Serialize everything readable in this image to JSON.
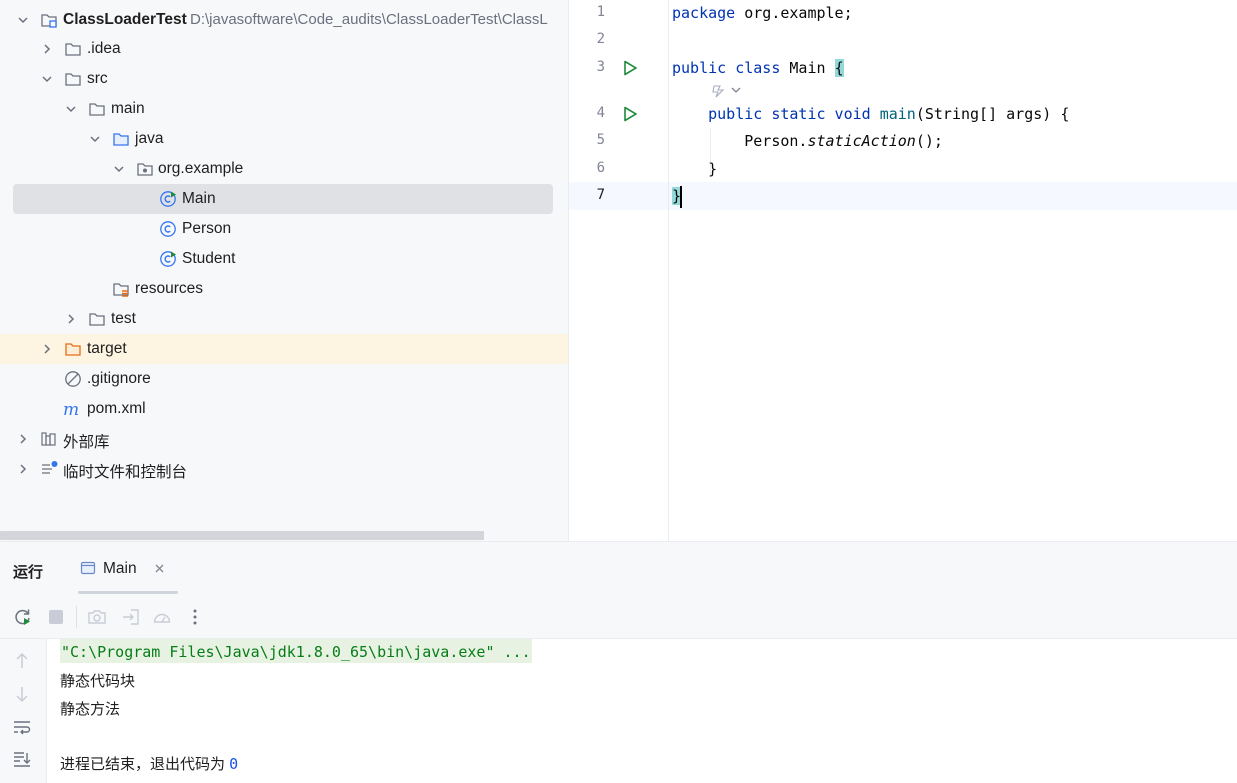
{
  "project_tree": {
    "root": {
      "name": "ClassLoaderTest",
      "path": "D:\\javasoftware\\Code_audits\\ClassLoaderTest\\ClassL"
    },
    "items": [
      {
        "label": "ClassLoaderTest",
        "type": "module"
      },
      {
        "label": ".idea",
        "type": "folder"
      },
      {
        "label": "src",
        "type": "folder"
      },
      {
        "label": "main",
        "type": "folder"
      },
      {
        "label": "java",
        "type": "source-folder"
      },
      {
        "label": "org.example",
        "type": "package"
      },
      {
        "label": "Main",
        "type": "java-class-runnable",
        "selected": true
      },
      {
        "label": "Person",
        "type": "java-class"
      },
      {
        "label": "Student",
        "type": "java-class-runnable"
      },
      {
        "label": "resources",
        "type": "resources-folder"
      },
      {
        "label": "test",
        "type": "folder"
      },
      {
        "label": "target",
        "type": "excluded-folder"
      },
      {
        "label": ".gitignore",
        "type": "ignore-file"
      },
      {
        "label": "pom.xml",
        "type": "maven-file"
      },
      {
        "label": "外部库",
        "type": "libraries"
      },
      {
        "label": "临时文件和控制台",
        "type": "scratches"
      }
    ]
  },
  "editor": {
    "line_numbers": [
      "1",
      "2",
      "3",
      "4",
      "5",
      "6",
      "7"
    ],
    "current_line": "7",
    "code": {
      "l1_kw": "package",
      "l1_rest": " org.example;",
      "l3_kw": "public class",
      "l3_name": " Main ",
      "l3_brace": "{",
      "l4_indent": "    ",
      "l4_kw": "public static void",
      "l4_fn": " main",
      "l4_rest": "(String[] args) {",
      "l5_indent": "        ",
      "l5_obj": "Person.",
      "l5_method": "staticAction",
      "l5_rest": "();",
      "l6": "    }",
      "l7": "}"
    }
  },
  "run_panel": {
    "title": "运行",
    "tab_label": "Main",
    "console": {
      "command": "\"C:\\Program Files\\Java\\jdk1.8.0_65\\bin\\java.exe\" ...",
      "line1": "静态代码块",
      "line2": "静态方法",
      "exit_text": "进程已结束，退出代码为 ",
      "exit_code": "0"
    }
  },
  "colors": {
    "keyword": "#0033b3",
    "function": "#00627a",
    "selection": "#dfe1e5",
    "excluded_row": "#fdf4e1",
    "run_green": "#208a3c",
    "brace_match": "#93d9d9"
  }
}
